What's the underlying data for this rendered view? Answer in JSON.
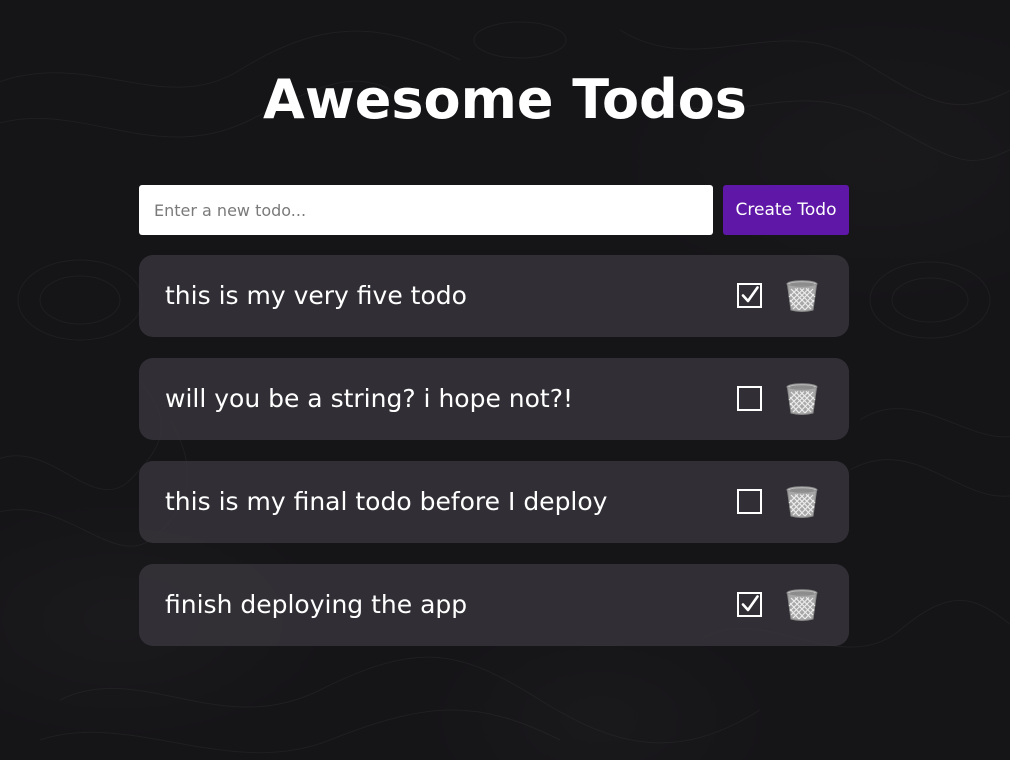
{
  "header": {
    "title": "Awesome Todos"
  },
  "new_todo": {
    "placeholder": "Enter a new todo...",
    "value": "",
    "create_label": "Create Todo"
  },
  "todos": [
    {
      "text": "this is my very five todo",
      "completed": true
    },
    {
      "text": "will you be a string? i hope not?!",
      "completed": false
    },
    {
      "text": "this is my final todo before I deploy",
      "completed": false
    },
    {
      "text": "finish deploying the app",
      "completed": true
    }
  ],
  "colors": {
    "background": "#151417",
    "accent": "#5e17a6",
    "card": "#39363d",
    "text": "#ffffff"
  },
  "icons": {
    "checkbox_checked": "checkmark-icon",
    "delete": "trash-bin-icon"
  }
}
